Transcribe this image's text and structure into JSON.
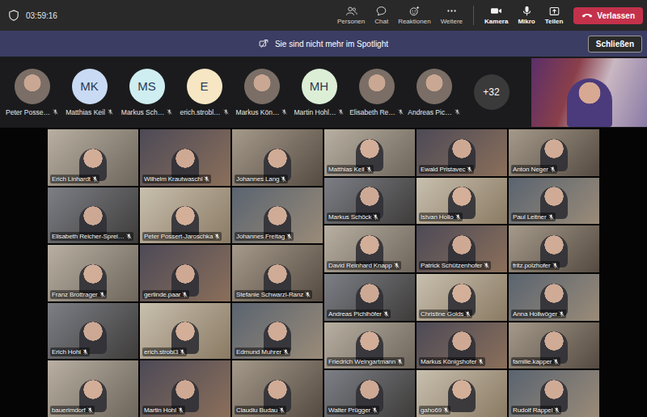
{
  "top_bar": {
    "timer": "03:59:16",
    "actions": [
      {
        "label": "Personen"
      },
      {
        "label": "Chat"
      },
      {
        "label": "Reaktionen"
      },
      {
        "label": "Weitere"
      }
    ],
    "media": [
      {
        "label": "Kamera"
      },
      {
        "label": "Mikro"
      },
      {
        "label": "Teilen"
      }
    ],
    "leave_button": "Verlassen"
  },
  "banner": {
    "text": "Sie sind nicht mehr im Spotlight",
    "button": "Schließen"
  },
  "participant_strip": {
    "items": [
      {
        "name": "Peter Posse…",
        "kind": "photo",
        "muted": true
      },
      {
        "name": "Matthias Keil",
        "kind": "initials",
        "initials": "MK",
        "color": "#c9dbf4",
        "muted": true
      },
      {
        "name": "Markus Sch…",
        "kind": "initials",
        "initials": "MS",
        "color": "#cfeef2",
        "muted": true
      },
      {
        "name": "erich.strobl…",
        "kind": "initials",
        "initials": "E",
        "color": "#f7e6c4",
        "muted": true
      },
      {
        "name": "Markus Kön…",
        "kind": "photo",
        "muted": true
      },
      {
        "name": "Martin Hohl…",
        "kind": "initials",
        "initials": "MH",
        "color": "#dcefd6",
        "muted": true
      },
      {
        "name": "Elisabeth Re…",
        "kind": "photo",
        "muted": true
      },
      {
        "name": "Andreas Pic…",
        "kind": "photo",
        "muted": true
      }
    ],
    "overflow": "+32"
  },
  "video_grid": {
    "left_tiles": [
      {
        "name": "Erich Linhardt",
        "muted": true
      },
      {
        "name": "Wilhelm Krautwaschl",
        "muted": true
      },
      {
        "name": "Johannes Lang",
        "muted": true
      },
      {
        "name": "Elisabeth Reicher-Sprei…",
        "muted": true
      },
      {
        "name": "Peter Possert-Jaroschka",
        "muted": true
      },
      {
        "name": "Johannes Freitag",
        "muted": true
      },
      {
        "name": "Franz Brottrager",
        "muted": true
      },
      {
        "name": "gerlinde.paar",
        "muted": true
      },
      {
        "name": "Stefanie Schwarzl-Ranz",
        "muted": true
      },
      {
        "name": "Erich Hohl",
        "muted": true
      },
      {
        "name": "erich.strobl3",
        "muted": true
      },
      {
        "name": "Edmund Muhrer",
        "muted": true
      },
      {
        "name": "bauerimdorf",
        "muted": true
      },
      {
        "name": "Martin Hohl",
        "muted": true
      },
      {
        "name": "Claudiu Budau",
        "muted": true
      }
    ],
    "right_tiles": [
      {
        "name": "Matthias Keil",
        "muted": true
      },
      {
        "name": "Ewald Pristavec",
        "muted": true
      },
      {
        "name": "Anton Neger",
        "muted": true
      },
      {
        "name": "Markus Schöck",
        "muted": true
      },
      {
        "name": "Istvan Hollo",
        "muted": true
      },
      {
        "name": "Paul Leitner",
        "muted": true
      },
      {
        "name": "David Reinhard Knapp",
        "muted": true
      },
      {
        "name": "Patrick Schützenhofer",
        "muted": true
      },
      {
        "name": "fritz.polzhofer",
        "muted": true
      },
      {
        "name": "Andreas Pichlhöfer",
        "muted": true
      },
      {
        "name": "Christine Golds",
        "muted": true
      },
      {
        "name": "Anna Hollwöger",
        "muted": true
      },
      {
        "name": "Friedrich Weingartmann",
        "muted": true
      },
      {
        "name": "Markus Königshofer",
        "muted": true
      },
      {
        "name": "familie.kapper",
        "muted": true
      },
      {
        "name": "Walter Prügger",
        "muted": true
      },
      {
        "name": "gaho69",
        "muted": true
      },
      {
        "name": "Rudolf Rappel",
        "muted": true
      }
    ]
  }
}
